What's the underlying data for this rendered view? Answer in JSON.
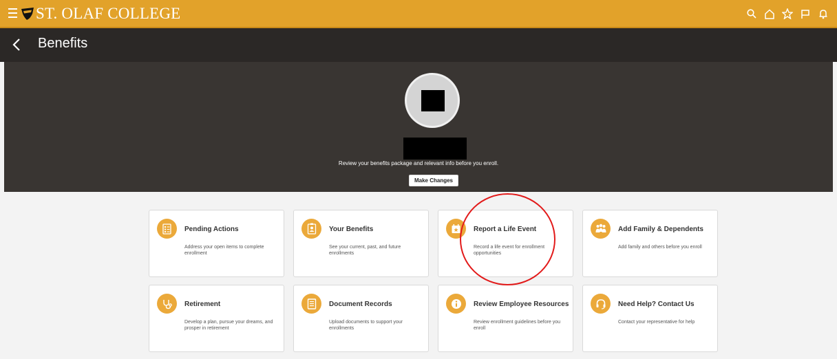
{
  "header": {
    "brand": "ST. OLAF COLLEGE",
    "colors": {
      "brand_bar": "#e2a22a",
      "title_bar": "#2b2826",
      "hero": "#393532",
      "card_icon": "#eba93a",
      "annotation": "#e21a1a"
    },
    "icons": [
      "search-icon",
      "home-icon",
      "star-icon",
      "flag-icon",
      "bell-icon"
    ]
  },
  "titlebar": {
    "title": "Benefits"
  },
  "hero": {
    "message": "Review your benefits package and relevant info before you enroll.",
    "button_label": "Make Changes"
  },
  "cards": [
    {
      "icon": "checklist-icon",
      "title": "Pending Actions",
      "description": "Address your open items to complete enrollment"
    },
    {
      "icon": "id-badge-icon",
      "title": "Your Benefits",
      "description": "See your current, past, and future enrollments"
    },
    {
      "icon": "calendar-star-icon",
      "title": "Report a Life Event",
      "description": "Record a life event for enrollment opportunities"
    },
    {
      "icon": "family-icon",
      "title": "Add Family & Dependents",
      "description": "Add family and others before you enroll"
    },
    {
      "icon": "stethoscope-icon",
      "title": "Retirement",
      "description": "Develop a plan, pursue your dreams, and prosper in retirement"
    },
    {
      "icon": "document-icon",
      "title": "Document Records",
      "description": "Upload documents to support your enrollments"
    },
    {
      "icon": "info-icon",
      "title": "Review Employee Resources",
      "description": "Review enrollment guidelines before you enroll"
    },
    {
      "icon": "headset-icon",
      "title": "Need Help? Contact Us",
      "description": "Contact your representative for help"
    }
  ]
}
